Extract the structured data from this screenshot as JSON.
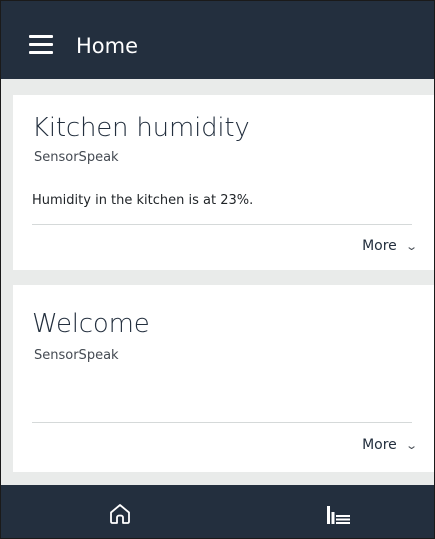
{
  "header": {
    "title": "Home",
    "menu_icon": "hamburger-menu-icon"
  },
  "cards": [
    {
      "title": "Kitchen humidity",
      "skill": "SensorSpeak",
      "body": "Humidity in the kitchen is at 23%.",
      "more_label": "More"
    },
    {
      "title": "Welcome",
      "skill": "SensorSpeak",
      "body": "",
      "more_label": "More"
    }
  ],
  "footer": {
    "items": [
      {
        "icon": "home-icon"
      },
      {
        "icon": "activity-bars-icon"
      }
    ]
  },
  "colors": {
    "header_bg": "#232f3e",
    "page_bg": "#e9ebea",
    "card_bg": "#ffffff"
  }
}
